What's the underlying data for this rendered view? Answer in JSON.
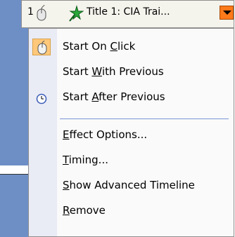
{
  "header": {
    "number": "1",
    "title": "Title 1: CIA Trai..."
  },
  "menu": {
    "items": [
      {
        "label_pre": "Start On ",
        "label_u": "C",
        "label_post": "lick"
      },
      {
        "label_pre": "Start ",
        "label_u": "W",
        "label_post": "ith Previous"
      },
      {
        "label_pre": "Start ",
        "label_u": "A",
        "label_post": "fter Previous"
      },
      {
        "label_pre": "",
        "label_u": "E",
        "label_post": "ffect Options..."
      },
      {
        "label_pre": "",
        "label_u": "T",
        "label_post": "iming..."
      },
      {
        "label_pre": "",
        "label_u": "S",
        "label_post": "how Advanced Timeline"
      },
      {
        "label_pre": "",
        "label_u": "R",
        "label_post": "emove"
      }
    ]
  },
  "colors": {
    "accent_orange": "#ff7a1a",
    "checked_highlight": "#ffc87a",
    "separator": "#7a96d6"
  },
  "icons": {
    "header_trigger": "mouse-icon",
    "effect": "star-icon",
    "start_on_click": "mouse-icon",
    "start_after_previous": "clock-icon",
    "dropdown": "chevron-down-icon"
  }
}
